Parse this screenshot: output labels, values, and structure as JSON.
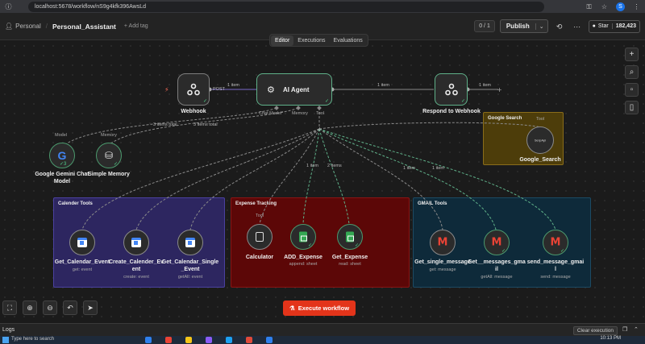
{
  "browser": {
    "url": "localhost:5678/workflow/nS9g4kfk396AwsLd"
  },
  "header": {
    "project": "Personal",
    "workflow_name": "Personal_Assistant",
    "add_tag": "+ Add tag",
    "counter": "0 / 1",
    "publish": "Publish",
    "github_star": "Star",
    "github_count": "182,423"
  },
  "tabs": [
    "Editor",
    "Executions",
    "Evaluations"
  ],
  "nodes": {
    "webhook": {
      "label": "Webhook"
    },
    "agent": {
      "label": "AI Agent",
      "handle_chat": "Chat Model*",
      "handle_memory": "Memory",
      "handle_tool": "Tool"
    },
    "respond": {
      "label": "Respond to Webhook"
    },
    "gemini": {
      "label_line1": "Google Gemini Chat",
      "label_line2": "Model",
      "top": "Model",
      "badge": "3"
    },
    "memory": {
      "label": "Simple Memory",
      "top": "Memory"
    },
    "gsearch": {
      "label": "Google_Search",
      "inner": "SerpApi",
      "top": "Tool"
    }
  },
  "edges": {
    "post": "POST",
    "webhook_agent": "1 item",
    "agent_respond": "1 item",
    "respond_out": "1 item",
    "items_total_a": "3 items total",
    "items_total_b": "3 items total",
    "item_add": "1 item",
    "items_get": "2 items",
    "item_gm1": "1 item",
    "item_gm2": "1 item"
  },
  "stickies": {
    "google_search": "Google Search",
    "calendar": "Calender Tools",
    "expense": "Expense Tracking",
    "gmail": "GMAIL Tools"
  },
  "tools": {
    "cal_get": {
      "label": "Get_Calendar_Event",
      "sub": "get: event"
    },
    "cal_create": {
      "label_line1": "Create_Calender_Ev",
      "label_line2": "ent",
      "sub": "create: event"
    },
    "cal_single": {
      "label_line1": "Get_Calendar_Single",
      "label_line2": "_Event",
      "sub": "getAll: event"
    },
    "calculator": {
      "label": "Calculator",
      "top": "Tool"
    },
    "add_expense": {
      "label": "ADD_Expense",
      "sub": "append: sheet"
    },
    "get_expense": {
      "label": "Get_Expense",
      "sub": "read: sheet"
    },
    "gm_single": {
      "label": "Get_single_message",
      "sub": "get: message"
    },
    "gm_many": {
      "label_line1": "Get__messages_gma",
      "label_line2": "il",
      "sub": "getAll: message"
    },
    "gm_send": {
      "label_line1": "send_message_gmai",
      "label_line2": "l",
      "sub": "send: message"
    }
  },
  "execute": "Execute workflow",
  "logs": {
    "title": "Logs",
    "clear": "Clear execution"
  },
  "taskbar": {
    "search": "Type here to search",
    "time": "10:13 PM"
  },
  "colors": {
    "google_search_sticky": "#4d3d0a",
    "calendar_sticky": "#2d2660",
    "expense_sticky": "#5c0707",
    "gmail_sticky": "#0e2a3a",
    "execute": "#e3341a",
    "success": "#4fd18b"
  }
}
